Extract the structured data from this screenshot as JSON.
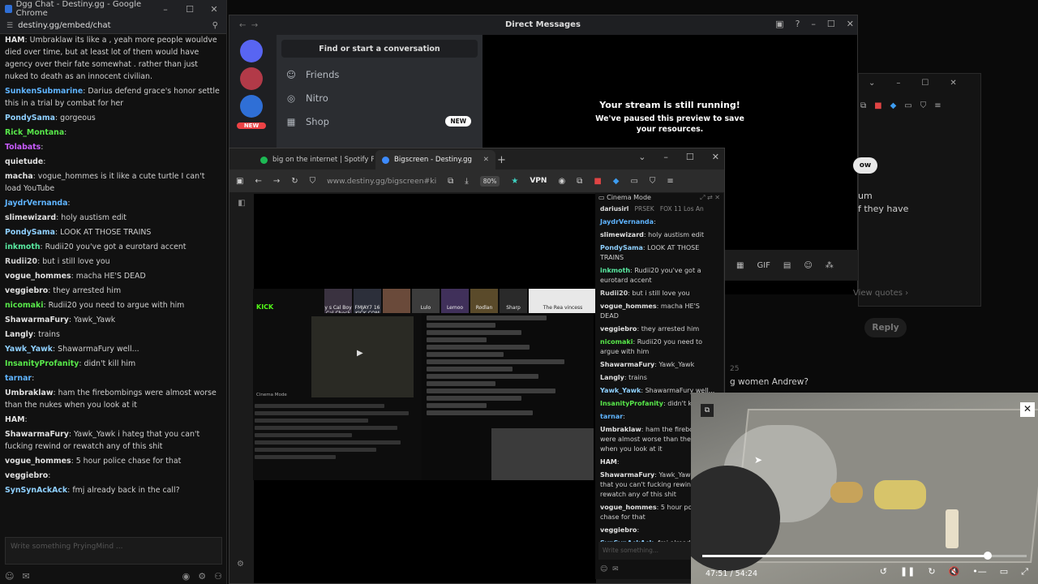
{
  "chat_window": {
    "title": "Dgg Chat - Destiny.gg - Google Chrome",
    "url": "destiny.gg/embed/chat",
    "input_placeholder": "Write something PryingMind ...",
    "messages": [
      {
        "user": "HAM",
        "text": "Umbraklaw its like a , yeah more people wouldve died over time, but at least lot of them would have agency over their fate somewhat . rather than just nuked to death as an innocent civilian.",
        "color": "#e0e0e0"
      },
      {
        "user": "SunkenSubmarine",
        "text": "Darius defend grace's honor settle this in a trial by combat for her",
        "color": "#5fb4ff"
      },
      {
        "user": "PondySama",
        "text": "gorgeous",
        "color": "#8fd0ff"
      },
      {
        "user": "Rick_Montana",
        "text": "",
        "color": "#58e84a"
      },
      {
        "user": "Tolabats",
        "text": "",
        "color": "#c95cff"
      },
      {
        "user": "quietude",
        "text": "",
        "color": "#e0e0e0"
      },
      {
        "user": "macha",
        "text": "vogue_hommes is it like a cute turtle I can't load YouTube",
        "color": "#e0e0e0"
      },
      {
        "user": "JaydrVernanda",
        "text": "",
        "color": "#5fb4ff"
      },
      {
        "user": "slimewizard",
        "text": "holy austism edit",
        "color": "#e0e0e0"
      },
      {
        "user": "PondySama",
        "text": "LOOK AT THOSE TRAINS",
        "color": "#8fd0ff"
      },
      {
        "user": "inkmoth",
        "text": "Rudii20 you've got a eurotard accent",
        "color": "#58e8a0"
      },
      {
        "user": "Rudii20",
        "text": "but i still love you",
        "color": "#cfcfcf"
      },
      {
        "user": "vogue_hommes",
        "text": "macha HE'S DEAD",
        "color": "#e0e0e0"
      },
      {
        "user": "veggiebro",
        "text": "they arrested him",
        "color": "#e0e0e0"
      },
      {
        "user": "nicomaki",
        "text": "Rudii20 you need to argue with him",
        "color": "#58e84a"
      },
      {
        "user": "ShawarmaFury",
        "text": "Yawk_Yawk",
        "color": "#e0e0e0"
      },
      {
        "user": "Langly",
        "text": "trains",
        "color": "#e0e0e0"
      },
      {
        "user": "Yawk_Yawk",
        "text": "ShawarmaFury well...",
        "color": "#8fd0ff"
      },
      {
        "user": "InsanityProfanity",
        "text": "didn't kill him",
        "color": "#58e84a"
      },
      {
        "user": "tarnar",
        "text": "",
        "color": "#5fb4ff"
      },
      {
        "user": "Umbraklaw",
        "text": "ham the firebombings were almost worse than the nukes when you look at it",
        "color": "#e0e0e0"
      },
      {
        "user": "HAM",
        "text": "",
        "color": "#e0e0e0"
      },
      {
        "user": "ShawarmaFury",
        "text": "Yawk_Yawk i hateg that you can't fucking rewind or rewatch any of this shit",
        "color": "#e0e0e0"
      },
      {
        "user": "vogue_hommes",
        "text": "5 hour police chase for that",
        "color": "#e0e0e0"
      },
      {
        "user": "veggiebro",
        "text": "",
        "color": "#e0e0e0"
      },
      {
        "user": "SynSynAckAck",
        "text": "fmj already back in the call?",
        "color": "#8fd0ff"
      }
    ]
  },
  "discord": {
    "title": "Direct Messages",
    "search": "Find or start a conversation",
    "nav": [
      {
        "label": "Friends",
        "icon": "friends-icon"
      },
      {
        "label": "Nitro",
        "icon": "nitro-icon"
      },
      {
        "label": "Shop",
        "icon": "shop-icon",
        "badge": "NEW"
      }
    ],
    "rail_badge": "NEW",
    "stream_title": "Your stream is still running!",
    "stream_body": "We've paused this preview to save your resources."
  },
  "background_window": {
    "follow": "ow",
    "text1": "um\nf they have",
    "view_quotes": "View quotes ›",
    "reply": "Reply",
    "frag_time": "25",
    "frag_text": "g women Andrew?"
  },
  "browser": {
    "tabs": [
      {
        "label": "big on the internet | Spotify Pla",
        "active": false,
        "color": "#1db954"
      },
      {
        "label": "Bigscreen - Destiny.gg",
        "active": true,
        "color": "#3d8bfd"
      }
    ],
    "url": "www.destiny.gg/bigscreen#ki",
    "zoom": "80%",
    "vpn": "VPN",
    "mini_stream": {
      "kick": "KICK",
      "thumbs": [
        "y s Cal Boy Cal Check ller",
        "FMJAY7 16 KICK.COM",
        "",
        "Lulo",
        "Lemoo",
        "Rodlan",
        "Sharp",
        "The Rea vincess"
      ],
      "cinema": "Cinema Mode"
    }
  },
  "cinema_chat": {
    "header": "Cinema Mode",
    "tabs": [
      "dariusirl",
      "PRSEK",
      "FOX 11 Los An"
    ],
    "input_placeholder": "Write something...",
    "messages": [
      {
        "user": "JaydrVernanda",
        "text": "",
        "color": "#5fb4ff"
      },
      {
        "user": "slimewizard",
        "text": "holy austism edit",
        "color": "#e0e0e0"
      },
      {
        "user": "PondySama",
        "text": "LOOK AT THOSE TRAINS",
        "color": "#8fd0ff"
      },
      {
        "user": "inkmoth",
        "text": "Rudii20 you've got a eurotard accent",
        "color": "#58e8a0"
      },
      {
        "user": "Rudii20",
        "text": "but i still love you",
        "color": "#cfcfcf"
      },
      {
        "user": "vogue_hommes",
        "text": "macha HE'S DEAD",
        "color": "#e0e0e0"
      },
      {
        "user": "veggiebro",
        "text": "they arrested him",
        "color": "#e0e0e0"
      },
      {
        "user": "nicomaki",
        "text": "Rudii20 you need to argue with him",
        "color": "#58e84a"
      },
      {
        "user": "ShawarmaFury",
        "text": "Yawk_Yawk",
        "color": "#e0e0e0"
      },
      {
        "user": "Langly",
        "text": "trains",
        "color": "#e0e0e0"
      },
      {
        "user": "Yawk_Yawk",
        "text": "ShawarmaFury well...",
        "color": "#8fd0ff"
      },
      {
        "user": "InsanityProfanity",
        "text": "didn't kill him",
        "color": "#58e84a"
      },
      {
        "user": "tarnar",
        "text": "",
        "color": "#5fb4ff"
      },
      {
        "user": "Umbraklaw",
        "text": "ham the firebombings were almost worse than the nukes when you look at it",
        "color": "#e0e0e0"
      },
      {
        "user": "HAM",
        "text": "",
        "color": "#e0e0e0"
      },
      {
        "user": "ShawarmaFury",
        "text": "Yawk_Yawk i hateg that you can't fucking rewind or rewatch any of this shit",
        "color": "#e0e0e0"
      },
      {
        "user": "vogue_hommes",
        "text": "5 hour police chase for that",
        "color": "#e0e0e0"
      },
      {
        "user": "veggiebro",
        "text": "",
        "color": "#e0e0e0"
      },
      {
        "user": "SynSynAckAck",
        "text": "fmj already back in the call?",
        "color": "#8fd0ff"
      }
    ]
  },
  "pip": {
    "time": "47:51 / 54:24",
    "progress": 0.88
  }
}
